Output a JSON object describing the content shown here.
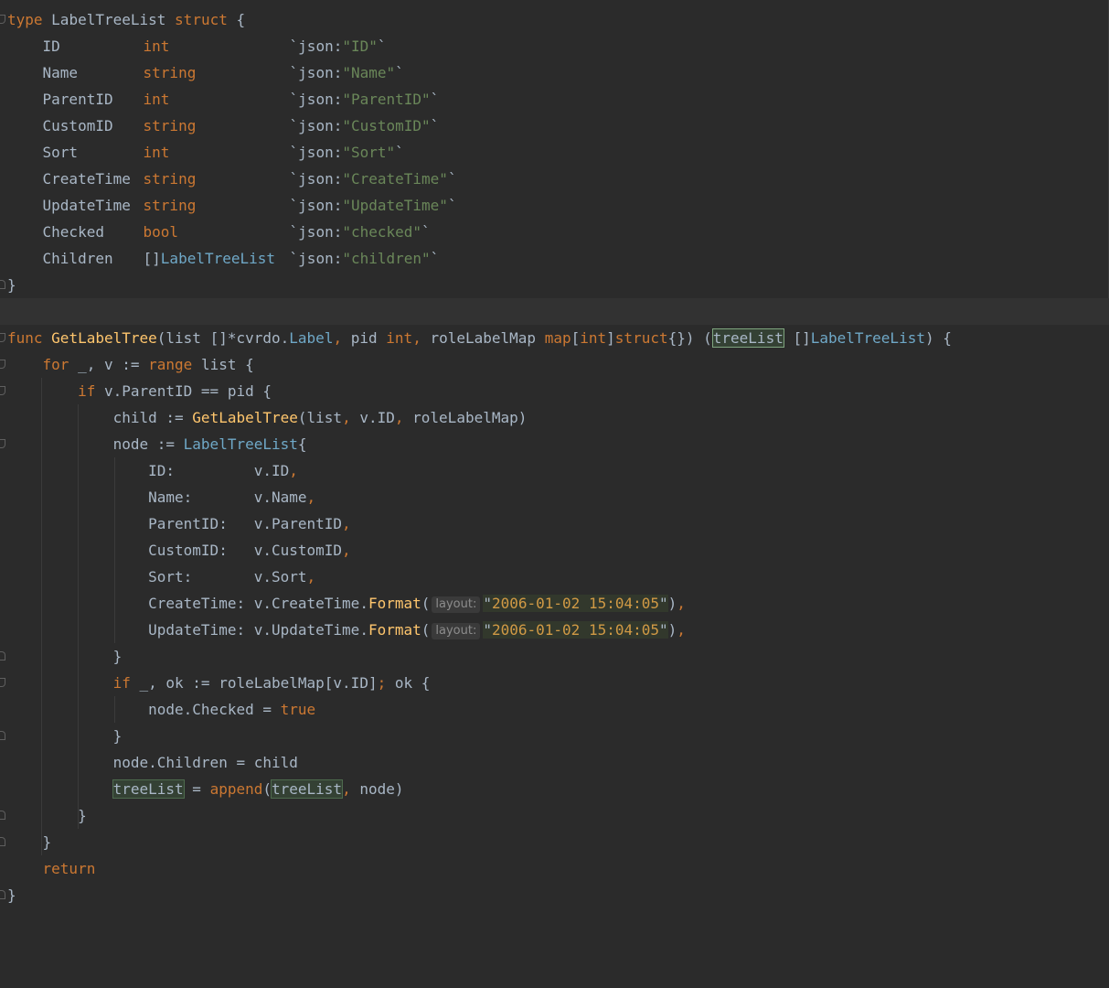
{
  "editor": {
    "language": "Go",
    "colors": {
      "background": "#2b2b2b",
      "keyword": "#cc7832",
      "function": "#ffc66d",
      "string": "#6a8759",
      "type_ref": "#6fa8c7",
      "text": "#a9b7c6",
      "usage_highlight": "#344134"
    },
    "struct_decl": {
      "kw_type": "type",
      "name": "LabelTreeList",
      "kw_struct": "struct",
      "open": "{",
      "close": "}",
      "fields": [
        {
          "name": "ID",
          "type": "int",
          "tag_key": "json:",
          "tag_val": "\"ID\""
        },
        {
          "name": "Name",
          "type": "string",
          "tag_key": "json:",
          "tag_val": "\"Name\""
        },
        {
          "name": "ParentID",
          "type": "int",
          "tag_key": "json:",
          "tag_val": "\"ParentID\""
        },
        {
          "name": "CustomID",
          "type": "string",
          "tag_key": "json:",
          "tag_val": "\"CustomID\""
        },
        {
          "name": "Sort",
          "type": "int",
          "tag_key": "json:",
          "tag_val": "\"Sort\""
        },
        {
          "name": "CreateTime",
          "type": "string",
          "tag_key": "json:",
          "tag_val": "\"CreateTime\""
        },
        {
          "name": "UpdateTime",
          "type": "string",
          "tag_key": "json:",
          "tag_val": "\"UpdateTime\""
        },
        {
          "name": "Checked",
          "type": "bool",
          "tag_key": "json:",
          "tag_val": "\"checked\""
        },
        {
          "name": "Children",
          "type_prefix": "[]",
          "type": "LabelTreeList",
          "tag_key": "json:",
          "tag_val": "\"children\""
        }
      ]
    },
    "func_decl": {
      "kw_func": "func",
      "name": "GetLabelTree",
      "p1": "list",
      "p1_type_a": "[]*cvrdo.",
      "p1_type_b": "Label",
      "p2": "pid",
      "p2_type": "int",
      "p3": "roleLabelMap",
      "p3_map": "map",
      "p3_key": "int",
      "p3_val": "struct",
      "p3_tail": "{}",
      "ret_name": "treeList",
      "ret_prefix": "[]",
      "ret_type": "LabelTreeList"
    },
    "body": {
      "kw_for": "for",
      "for_vars": "_, v := ",
      "kw_range": "range",
      "range_expr": " list {",
      "kw_if": "if",
      "if_cond": " v.ParentID == pid {",
      "child_lhs": "child := ",
      "child_fn": "GetLabelTree",
      "child_args_a": "(list",
      "child_args_b": " v.ID",
      "child_args_c": " roleLabelMap)",
      "node_lhs": "node := ",
      "node_type": "LabelTreeList",
      "node_open": "{",
      "assigns": [
        {
          "key": "ID:         ",
          "val": "v.ID"
        },
        {
          "key": "Name:       ",
          "val": "v.Name"
        },
        {
          "key": "ParentID:   ",
          "val": "v.ParentID"
        },
        {
          "key": "CustomID:   ",
          "val": "v.CustomID"
        },
        {
          "key": "Sort:       ",
          "val": "v.Sort"
        }
      ],
      "create_key": "CreateTime: ",
      "create_val": "v.CreateTime.",
      "update_key": "UpdateTime: ",
      "update_val": "v.UpdateTime.",
      "format_fn": "Format",
      "hint_label": "layout:",
      "date_layout": "2006-01-02 15:04:05",
      "close_brace": "}",
      "if2_kw": "if",
      "if2_cond_a": " _, ok := roleLabelMap[v.ID]",
      "if2_cond_b": " ok {",
      "checked_lhs": "node.Checked = ",
      "checked_val": "true",
      "children_stmt": "node.Children = child",
      "tree_var": "treeList",
      "append_eq": " = ",
      "append_fn": "append",
      "append_tail": " node)",
      "kw_return": "return"
    }
  }
}
